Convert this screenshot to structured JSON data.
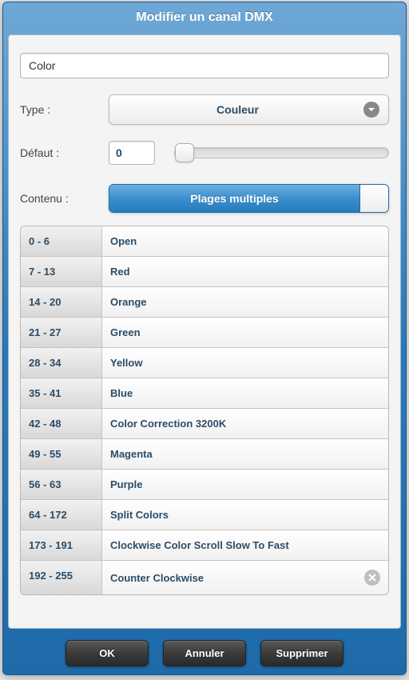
{
  "header": {
    "title": "Modifier un canal DMX"
  },
  "form": {
    "name": "Color",
    "typeLabel": "Type :",
    "typeValue": "Couleur",
    "defaultLabel": "Défaut :",
    "defaultValue": "0",
    "contentLabel": "Contenu :",
    "contentButton": "Plages multiples"
  },
  "ranges": [
    {
      "range": "0 - 6",
      "label": "Open"
    },
    {
      "range": "7 - 13",
      "label": "Red"
    },
    {
      "range": "14 - 20",
      "label": "Orange"
    },
    {
      "range": "21 - 27",
      "label": "Green"
    },
    {
      "range": "28 - 34",
      "label": "Yellow"
    },
    {
      "range": "35 - 41",
      "label": "Blue"
    },
    {
      "range": "42 - 48",
      "label": "Color Correction 3200K"
    },
    {
      "range": "49 - 55",
      "label": "Magenta"
    },
    {
      "range": "56 - 63",
      "label": "Purple"
    },
    {
      "range": "64 - 172",
      "label": "Split Colors"
    },
    {
      "range": "173 - 191",
      "label": "Clockwise Color Scroll Slow To Fast"
    },
    {
      "range": "192 - 255",
      "label": "Counter Clockwise",
      "deletable": true
    }
  ],
  "footer": {
    "ok": "OK",
    "cancel": "Annuler",
    "delete": "Supprimer"
  }
}
